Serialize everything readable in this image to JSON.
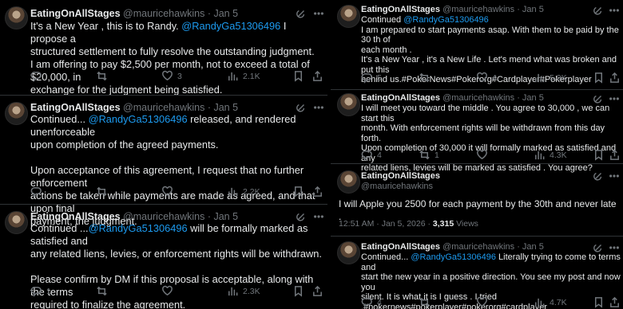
{
  "left": {
    "posts": [
      {
        "author": "EatingOnAllStages",
        "handle": "@mauricehawkins",
        "date": "· Jan 5",
        "lines": [
          "It's a New Year , this is to Randy. ",
          "@RandyGa51306496",
          " I propose a",
          "structured settlement to fully resolve the outstanding judgment.",
          "I am offering to pay $2,500 per month, not to exceed a total of $20,000, in",
          "exchange for the judgment being satisfied."
        ],
        "stats": {
          "reply": "",
          "retweet": "",
          "like": "3",
          "views": "2.1K"
        }
      },
      {
        "author": "EatingOnAllStages",
        "handle": "@mauricehawkins",
        "date": "· Jan 5",
        "lines": [
          "Continued... ",
          "@RandyGa51306496",
          " released, and rendered unenforceable",
          "upon completion of the agreed payments.",
          "",
          "Upon acceptance of this agreement, I request that no further enforcement",
          "actions be taken while payments are made as agreed, and that upon final",
          "payment, the judgment."
        ],
        "stats": {
          "reply": "",
          "retweet": "",
          "like": "",
          "views": "2.2K"
        }
      },
      {
        "author": "EatingOnAllStages",
        "handle": "@mauricehawkins",
        "date": "· Jan 5",
        "lines": [
          "Continued ...",
          "@RandyGa51306496",
          " will be formally marked as satisfied and",
          "any related liens, levies, or enforcement rights will be withdrawn.",
          "",
          "Please confirm by DM if this proposal is acceptable, along with the terms",
          "required to finalize the agreement."
        ],
        "stats": {
          "reply": "1",
          "retweet": "",
          "like": "",
          "views": "2.3K"
        }
      }
    ]
  },
  "right": {
    "posts": [
      {
        "author": "EatingOnAllStages",
        "handle": "@mauricehawkins",
        "date": "· Jan 5",
        "lines": [
          "Continued ",
          "@RandyGa51306496",
          "",
          "I am prepared to start payments asap. With them to be paid by the 30 th of",
          "each month .",
          "It's a New Year , it's a New Life . Let's mend what was broken and put this",
          "behind us.#PokerNews#Pokerorg#Cardplayer#Pokerplayer"
        ],
        "stats": {
          "reply": "5",
          "retweet": "",
          "like": "4",
          "views": "5.9K"
        }
      },
      {
        "author": "EatingOnAllStages",
        "handle": "@mauricehawkins",
        "date": "· Jan 5",
        "lines": [
          "I will meet you toward the middle . You agree to 30,000 , we can start this",
          "month. With enforcement rights will be withdrawn from this day forth.",
          "Upon completion of 30,000 it will formally marked as satisfied and any",
          "related liens, levies will be marked as satisfied . You agree?"
        ],
        "stats": {
          "reply": "4",
          "retweet": "1",
          "like": "",
          "views": "4.3K"
        }
      },
      {
        "author": "EatingOnAllStages",
        "handle": "@mauricehawkins",
        "text": "I will Apple you 2500 for each payment by the 30th and never late .",
        "meta_time": "12:51 AM · Jan 5, 2026 · ",
        "meta_views": "3,315",
        "meta_views_label": " Views"
      },
      {
        "author": "EatingOnAllStages",
        "handle": "@mauricehawkins",
        "date": "· Jan 5",
        "lines": [
          "Continued... ",
          "@RandyGa51306496",
          " Literally trying to come to terms and",
          "start the new year in a positive direction. You see my post and now you",
          "silent. It is what it is I guess . I tried",
          ".#pokernews#pokerplayer#pokerorg#cardplayer"
        ],
        "stats": {
          "reply": "4",
          "retweet": "",
          "like": "",
          "views": "4.7K"
        }
      }
    ]
  },
  "colors": {
    "background": "#000000",
    "text": "#e7e9ea",
    "muted": "#71767b",
    "link": "#1d9bf0",
    "divider": "#2f3336"
  },
  "icons": [
    "grok-icon",
    "more-icon",
    "reply-icon",
    "retweet-icon",
    "like-icon",
    "views-icon",
    "bookmark-icon",
    "share-icon"
  ]
}
